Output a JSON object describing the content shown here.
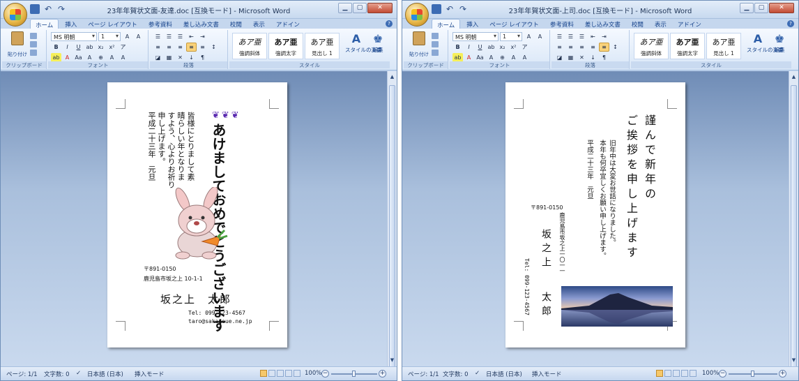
{
  "ribbon": {
    "tabs": [
      "ホーム",
      "挿入",
      "ページ レイアウト",
      "参考資料",
      "差し込み文書",
      "校閲",
      "表示",
      "アドイン"
    ],
    "font_name": "MS 明朝",
    "font_size": "1",
    "paste_label": "貼り付け",
    "groups": {
      "clipboard": "クリップボード",
      "font": "フォント",
      "paragraph": "段落",
      "styles": "スタイル"
    },
    "styles": [
      {
        "sample": "あア亜",
        "name": "強調斜体"
      },
      {
        "sample": "あア亜",
        "name": "強調太字"
      },
      {
        "sample": "あア亜",
        "name": "見出し 1"
      }
    ],
    "change_styles": "スタイルの変更",
    "edit": "編集"
  },
  "status": {
    "page": "ページ: 1/1",
    "words": "文字数: 0",
    "lang": "日本語 (日本)",
    "mode": "挿入モード",
    "zoom": "100%"
  },
  "windows": {
    "left": {
      "title": "23年年賀状文面-友達.doc [互換モード] - Microsoft Word",
      "card": {
        "headline": "あけましておめでとうございます",
        "greeting": [
          "皆様にとりまして素",
          "晴らしい年となりま",
          "すよう、心よりお祈り",
          "申し上げます。"
        ],
        "date": "平成二十三年　元旦",
        "zip": "〒891-0150",
        "address": "鹿児島市坂之上 10-1-1",
        "name": "坂之上　太郎",
        "tel": "Tel: 099-123-4567",
        "email": "taro@sakanoue.ne.jp"
      }
    },
    "right": {
      "title": "23年年賀状文面-上司.doc [互換モード] - Microsoft Word",
      "card": {
        "headline": [
          "謹んで新年の",
          "ご挨拶を申し上げます"
        ],
        "body": [
          "旧年中は大変お世話になりました。",
          "本年も何卒宜しくお願い申し上げます。"
        ],
        "date": "平成二十三年　元旦",
        "zip": "〒891-0150",
        "address": "鹿児島市坂之上一〇一一",
        "name_family": "坂之上",
        "name_given": "太郎",
        "tel": "Tel: 099-123-4567"
      }
    }
  },
  "colors": {
    "accent": "#15428b",
    "ribbon": "#d8e6f7",
    "workspace": "#8fa8cc"
  }
}
